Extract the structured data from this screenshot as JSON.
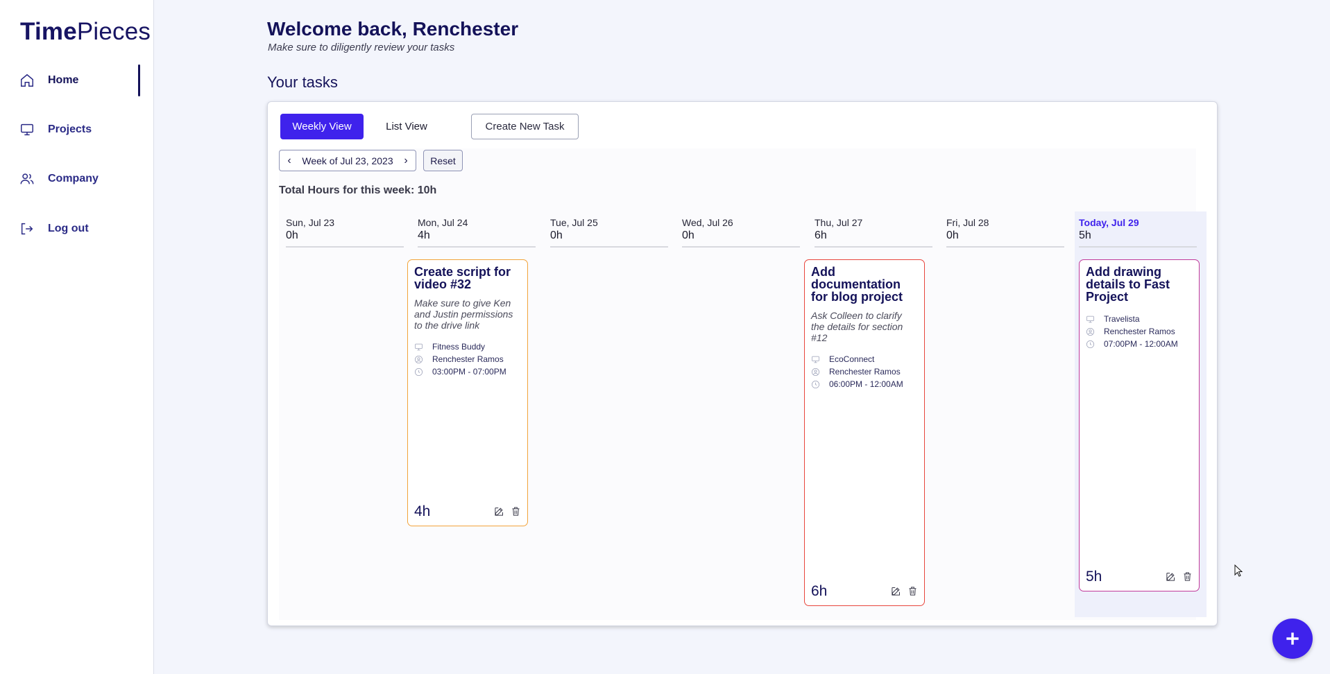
{
  "app": {
    "logo_bold": "Time",
    "logo_light": "Pieces"
  },
  "sidebar": {
    "items": [
      {
        "label": "Home",
        "icon": "home-icon"
      },
      {
        "label": "Projects",
        "icon": "monitor-icon"
      },
      {
        "label": "Company",
        "icon": "users-icon"
      },
      {
        "label": "Log out",
        "icon": "logout-icon"
      }
    ]
  },
  "header": {
    "welcome": "Welcome back, Renchester",
    "subtitle": "Make sure to diligently review your tasks",
    "section_title": "Your tasks"
  },
  "toolbar": {
    "weekly_view": "Weekly View",
    "list_view": "List View",
    "create_task": "Create New Task",
    "week_label": "Week of Jul 23, 2023",
    "reset": "Reset",
    "total_hours": "Total Hours for this week: 10h"
  },
  "days": [
    {
      "name": "Sun, Jul 23",
      "hours": "0h"
    },
    {
      "name": "Mon, Jul 24",
      "hours": "4h"
    },
    {
      "name": "Tue, Jul 25",
      "hours": "0h"
    },
    {
      "name": "Wed, Jul 26",
      "hours": "0h"
    },
    {
      "name": "Thu, Jul 27",
      "hours": "6h"
    },
    {
      "name": "Fri, Jul 28",
      "hours": "0h"
    },
    {
      "name": "Today, Jul 29",
      "hours": "5h"
    }
  ],
  "tasks": [
    {
      "title": "Create script for video #32",
      "description": "Make sure to give Ken and Justin permissions to the drive link",
      "project": "Fitness Buddy",
      "assignee": "Renchester Ramos",
      "time": "03:00PM - 07:00PM",
      "hours": "4h",
      "color": "#f2a33a"
    },
    {
      "title": "Add documentation for blog project",
      "description": "Ask Colleen to clarify the details for section #12",
      "project": "EcoConnect",
      "assignee": "Renchester Ramos",
      "time": "06:00PM - 12:00AM",
      "hours": "6h",
      "color": "#e8453c"
    },
    {
      "title": "Add drawing details to Fast Project",
      "description": "",
      "project": "Travelista",
      "assignee": "Renchester Ramos",
      "time": "07:00PM - 12:00AM",
      "hours": "5h",
      "color": "#c0399a"
    }
  ],
  "colors": {
    "accent": "#3f22ec",
    "navy": "#141259"
  }
}
